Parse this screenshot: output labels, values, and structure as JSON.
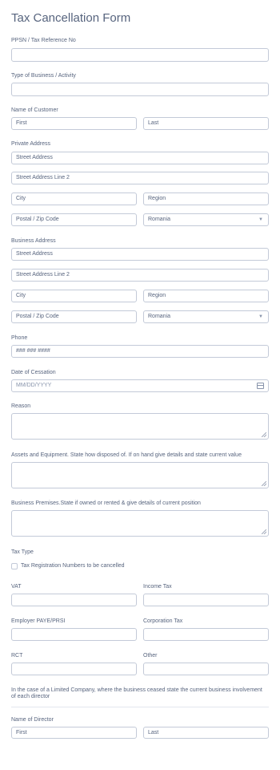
{
  "form": {
    "title": "Tax Cancellation Form",
    "ppsn": {
      "label": "PPSN / Tax Reference No",
      "value": ""
    },
    "business_type": {
      "label": "Type of Business / Activity",
      "value": ""
    },
    "customer_name": {
      "label": "Name of Customer",
      "first": "First",
      "last": "Last"
    },
    "private_address": {
      "label": "Private Address",
      "street1": "Street Address",
      "street2": "Street Address Line 2",
      "city": "City",
      "region": "Region",
      "postal": "Postal / Zip Code",
      "country": "Romania"
    },
    "business_address": {
      "label": "Business Address",
      "street1": "Street Address",
      "street2": "Street Address Line 2",
      "city": "City",
      "region": "Region",
      "postal": "Postal / Zip Code",
      "country": "Romania"
    },
    "phone": {
      "label": "Phone",
      "placeholder": "### ### ####"
    },
    "cessation_date": {
      "label": "Date of Cessation",
      "placeholder": "MM/DD/YYYY"
    },
    "reason": {
      "label": "Reason"
    },
    "assets": {
      "label": "Assets and Equipment. State how disposed of. If on hand give details and state current value"
    },
    "premises": {
      "label": "Business Premises.State if owned or rented & give details of current position"
    },
    "tax_type": {
      "label": "Tax Type",
      "option": "Tax Registration Numbers to be cancelled"
    },
    "vat": {
      "label": "VAT"
    },
    "income_tax": {
      "label": "Income Tax"
    },
    "employer": {
      "label": "Employer PAYE/PRSI"
    },
    "corporation_tax": {
      "label": "Corporation Tax"
    },
    "rct": {
      "label": "RCT"
    },
    "other": {
      "label": "Other"
    },
    "limited_company_note": "In the case of a Limited Company, where the business ceased state the current business involvement of each director",
    "director_name": {
      "label": "Name of Director",
      "first": "First",
      "last": "Last"
    }
  },
  "icons": {
    "dropdown": "chevron-down-icon",
    "date": "calendar-icon",
    "resize": "resize-grip-icon"
  }
}
